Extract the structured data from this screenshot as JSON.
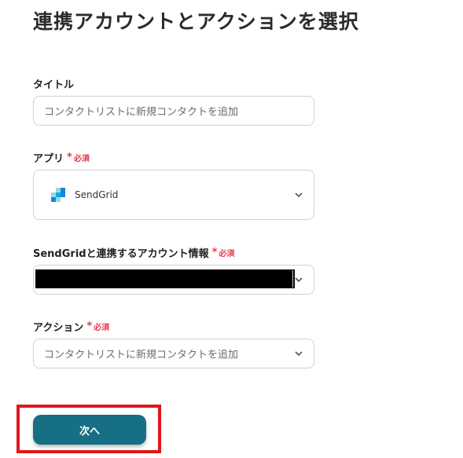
{
  "page": {
    "title": "連携アカウントとアクションを選択"
  },
  "fields": {
    "title": {
      "label": "タイトル",
      "value": "コンタクトリストに新規コンタクトを追加"
    },
    "app": {
      "label": "アプリ",
      "required": "必須",
      "value": "SendGrid",
      "icon": "sendgrid-logo"
    },
    "account": {
      "label": "SendGridと連携するアカウント情報",
      "required": "必須"
    },
    "action": {
      "label": "アクション",
      "required": "必須",
      "value": "コンタクトリストに新規コンタクトを追加"
    }
  },
  "buttons": {
    "next": "次へ"
  },
  "colors": {
    "primary": "#176f85",
    "required": "#e03c4a",
    "highlight": "#e0161c"
  }
}
